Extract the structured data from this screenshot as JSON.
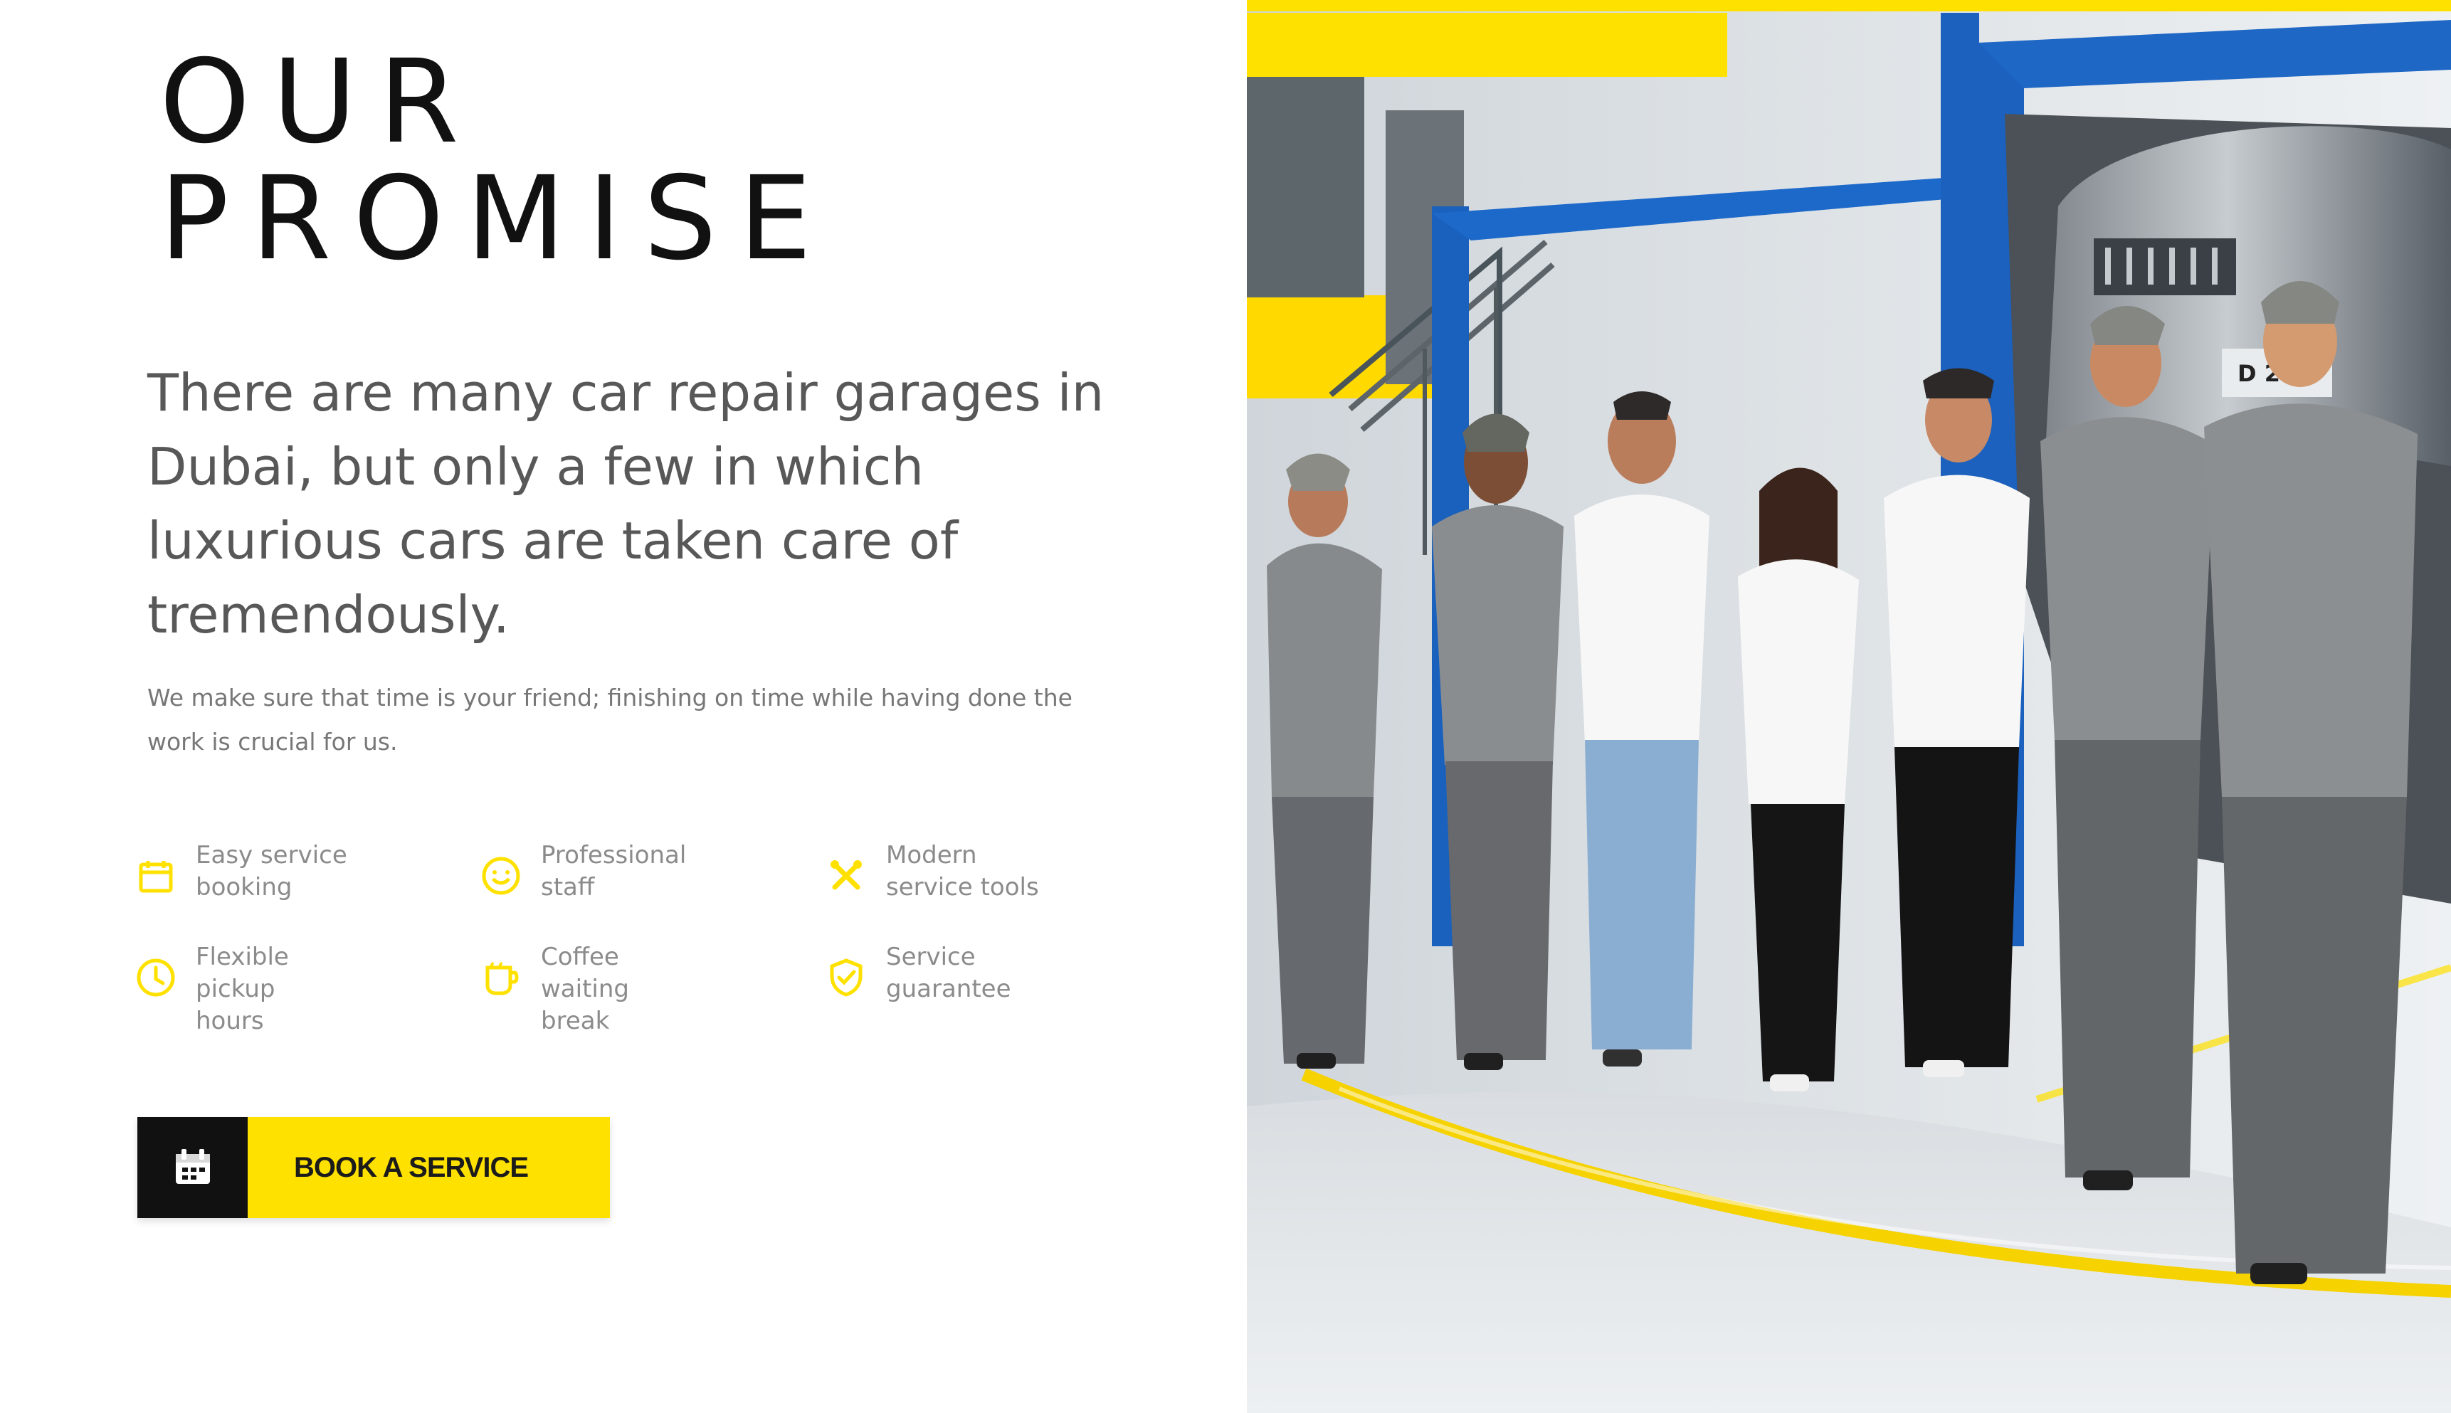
{
  "brand_colors": {
    "accent": "#ffe100",
    "dark": "#111111",
    "text": "#585858",
    "muted": "#8b8b8b"
  },
  "promise": {
    "title_lines": [
      "OUR",
      "PROMISE"
    ],
    "lead": "There are many car repair garages in Dubai, but only a few in which luxurious cars are taken care of tremendously.",
    "body": "We make sure that time is your friend; finishing on time while having done the work is crucial for us.",
    "features": [
      {
        "label": "Easy service\nbooking",
        "icon": "calendar-icon"
      },
      {
        "label": "Professional\nstaff",
        "icon": "smile-icon"
      },
      {
        "label": "Modern\nservice tools",
        "icon": "tools-icon"
      },
      {
        "label": "Flexible\npickup\nhours",
        "icon": "clock-icon"
      },
      {
        "label": "Coffee\nwaiting\nbreak",
        "icon": "coffee-icon"
      },
      {
        "label": "Service\nguarantee",
        "icon": "shield-icon"
      }
    ],
    "cta": {
      "label": "BOOK A SERVICE",
      "icon": "calendar-icon"
    }
  },
  "hero_image": {
    "content": "Garage team group photo"
  }
}
